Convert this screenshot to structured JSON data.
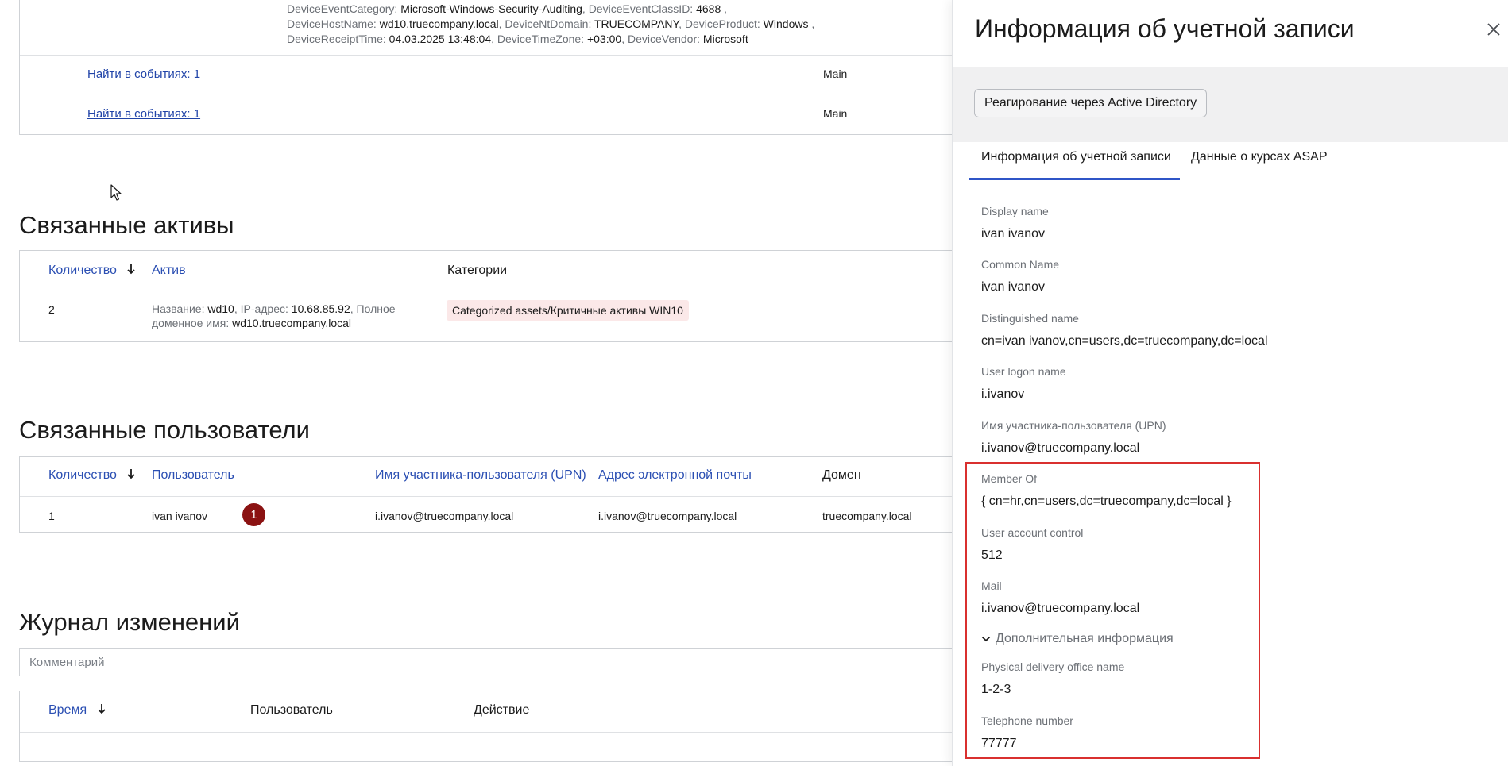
{
  "event_details": {
    "line1": [
      {
        "k": "DeviceEventCategory:",
        "v": "Microsoft-Windows-Security-Auditing"
      },
      {
        "k": ", DeviceEventClassID:",
        "v": "4688"
      },
      {
        "k": ",",
        "v": ""
      }
    ],
    "line2": [
      {
        "k": "DeviceHostName:",
        "v": "wd10.truecompany.local"
      },
      {
        "k": ", DeviceNtDomain:",
        "v": "TRUECOMPANY"
      },
      {
        "k": ", DeviceProduct:",
        "v": "Windows"
      },
      {
        "k": ",",
        "v": ""
      }
    ],
    "line3": [
      {
        "k": "DeviceReceiptTime:",
        "v": "04.03.2025 13:48:04"
      },
      {
        "k": ", DeviceTimeZone:",
        "v": "+03:00"
      },
      {
        "k": ", DeviceVendor:",
        "v": "Microsoft"
      }
    ]
  },
  "events_rows": [
    {
      "link": "Найти в событиях: 1",
      "source": "Main"
    },
    {
      "link": "Найти в событиях: 1",
      "source": "Main"
    }
  ],
  "assets": {
    "title": "Связанные активы",
    "columns": {
      "count": "Количество",
      "asset": "Актив",
      "categories": "Категории"
    },
    "row": {
      "count": "2",
      "name_label": "Название:",
      "name": "wd10",
      "ip_label": ", IP-адрес:",
      "ip": "10.68.85.92",
      "fqdn_label_1": ", Полное",
      "fqdn_label_2": "доменное имя:",
      "fqdn": "wd10.truecompany.local",
      "category": "Categorized assets/Критичные активы WIN10"
    }
  },
  "users": {
    "title": "Связанные пользователи",
    "columns": {
      "count": "Количество",
      "user": "Пользователь",
      "upn": "Имя участника-пользователя (UPN)",
      "email": "Адрес электронной почты",
      "domain": "Домен"
    },
    "row": {
      "count": "1",
      "user": "ivan ivanov",
      "badge": "1",
      "upn": "i.ivanov@truecompany.local",
      "email": "i.ivanov@truecompany.local",
      "domain": "truecompany.local"
    }
  },
  "changelog": {
    "title": "Журнал изменений",
    "comment_placeholder": "Комментарий",
    "columns": {
      "time": "Время",
      "user": "Пользователь",
      "action": "Действие"
    }
  },
  "panel": {
    "title": "Информация об учетной записи",
    "ad_button": "Реагирование через Active Directory",
    "tabs": [
      "Информация об учетной записи",
      "Данные о курсах ASAP"
    ],
    "fields": [
      {
        "label": "Display name",
        "value": "ivan ivanov"
      },
      {
        "label": "Common Name",
        "value": "ivan ivanov"
      },
      {
        "label": "Distinguished name",
        "value": "cn=ivan ivanov,cn=users,dc=truecompany,dc=local"
      },
      {
        "label": "User logon name",
        "value": "i.ivanov"
      },
      {
        "label": "Имя участника-пользователя (UPN)",
        "value": "i.ivanov@truecompany.local"
      },
      {
        "label": "Member Of",
        "value": "{ cn=hr,cn=users,dc=truecompany,dc=local }"
      },
      {
        "label": "User account control",
        "value": "512"
      },
      {
        "label": "Mail",
        "value": "i.ivanov@truecompany.local"
      }
    ],
    "additional_toggle": "Дополнительная информация",
    "additional_fields": [
      {
        "label": "Physical delivery office name",
        "value": "1-2-3"
      },
      {
        "label": "Telephone number",
        "value": "77777"
      }
    ],
    "highlight_color": "#d9302f",
    "accent_color": "#2f55c7"
  }
}
